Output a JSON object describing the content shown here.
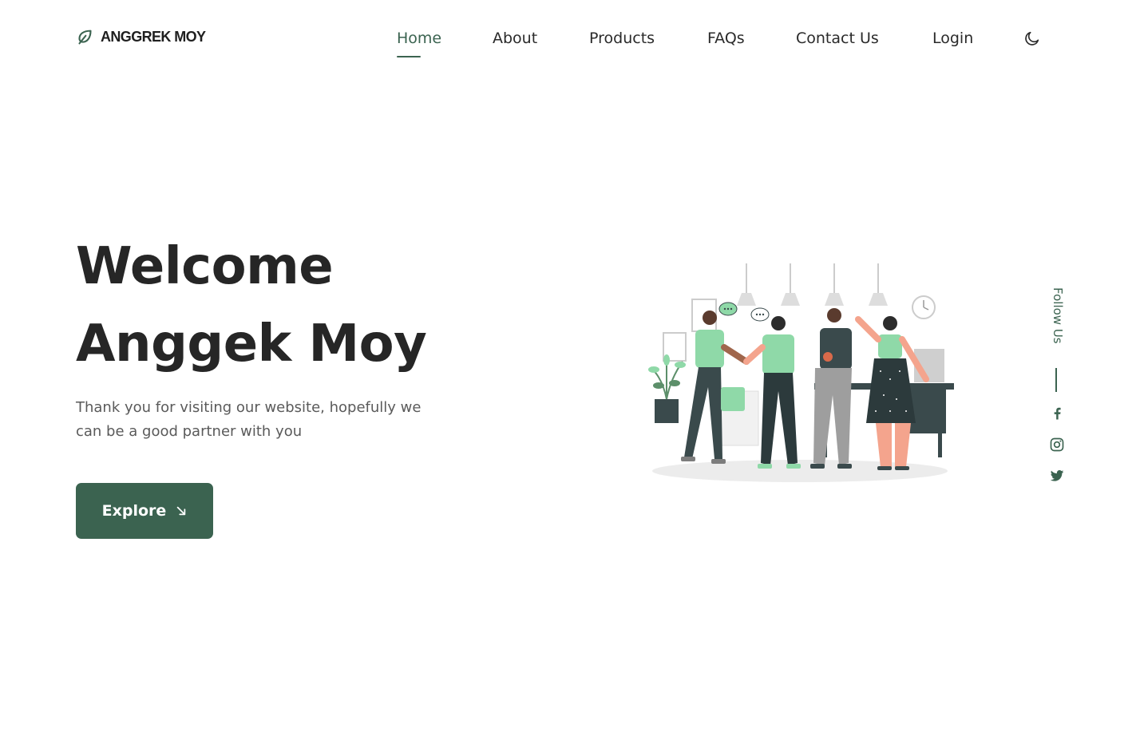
{
  "brand": {
    "name": "ANGGREK MOY",
    "icon": "leaf-icon"
  },
  "nav": {
    "items": [
      {
        "label": "Home",
        "active": true
      },
      {
        "label": "About",
        "active": false
      },
      {
        "label": "Products",
        "active": false
      },
      {
        "label": "FAQs",
        "active": false
      },
      {
        "label": "Contact Us",
        "active": false
      },
      {
        "label": "Login",
        "active": false
      }
    ],
    "theme_toggle_icon": "moon-icon"
  },
  "hero": {
    "title_line1": "Welcome",
    "title_line2": "Anggek Moy",
    "description": "Thank you for visiting our website, hopefully we can be a good partner with you",
    "button_label": "Explore",
    "button_icon": "arrow-down-right-icon",
    "illustration": "business-handshake-illustration"
  },
  "social": {
    "label": "Follow Us",
    "icons": [
      "facebook-icon",
      "instagram-icon",
      "twitter-icon"
    ]
  },
  "colors": {
    "primary": "#3b6350",
    "accent_green": "#8fd9a8",
    "text_dark": "#262626",
    "text_muted": "#5a5a5a",
    "background": "#ffffff"
  }
}
